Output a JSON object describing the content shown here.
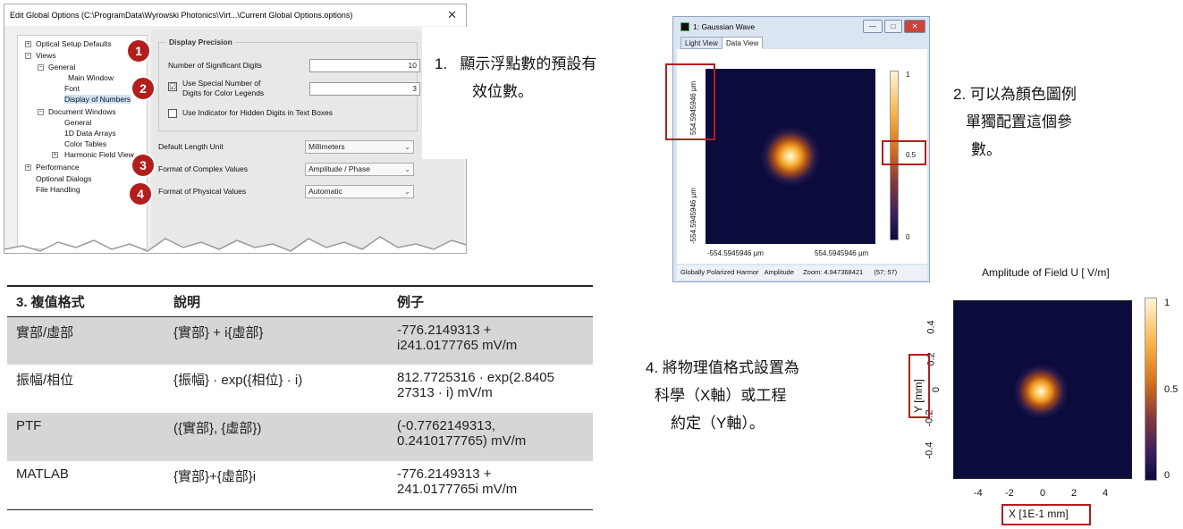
{
  "dialog": {
    "title": "Edit Global Options (C:\\ProgramData\\Wyrowski Photonics\\Virt...\\Current Global Options.options)",
    "close_glyph": "✕",
    "tree": [
      {
        "label": "Optical Setup Defaults",
        "expander": "+"
      },
      {
        "label": "Views",
        "expander": "−"
      },
      {
        "label": "General",
        "expander": "−"
      },
      {
        "label": "Main Window"
      },
      {
        "label": "Font"
      },
      {
        "label": "Display of Numbers",
        "selected": true
      },
      {
        "label": "Document Windows",
        "expander": "−"
      },
      {
        "label": "General"
      },
      {
        "label": "1D Data Arrays"
      },
      {
        "label": "Color Tables"
      },
      {
        "label": "Harmonic Field View",
        "expander": "+"
      },
      {
        "label": "Performance",
        "expander": "+"
      },
      {
        "label": "Optional Dialogs"
      },
      {
        "label": "File Handling"
      }
    ],
    "group_title": "Display Precision",
    "sig_digits_label": "Number of Significant Digits",
    "sig_digits_value": "10",
    "special_label_1": "Use Special Number of",
    "special_label_2": "Digits for Color Legends",
    "special_value": "3",
    "special_checked": "☑",
    "indicator_label": "Use Indicator for Hidden Digits in Text Boxes",
    "length_unit_label": "Default Length Unit",
    "length_unit_value": "Millimeters",
    "complex_label": "Format of Complex Values",
    "complex_value": "Amplitude / Phase",
    "physical_label": "Format of Physical Values",
    "physical_value": "Automatic",
    "badges": [
      "1",
      "2",
      "3",
      "4"
    ]
  },
  "annotations": {
    "a1_line1": "1.   顯示浮點數的預設有",
    "a1_line2": "效位數。",
    "a2_line1": "2. 可以為顏色圖例",
    "a2_line2": "單獨配置這個參",
    "a2_line3": "數。",
    "a4_line1": "4. 將物理值格式設置為",
    "a4_line2": "科學（X軸）或工程",
    "a4_line3": "約定（Y軸）。"
  },
  "table": {
    "headers": [
      "3. 複值格式",
      "說明",
      "例子"
    ],
    "rows": [
      [
        "實部/虛部",
        "{實部} + i{虛部}",
        "-776.2149313 +\ni241.0177765 mV/m"
      ],
      [
        "振幅/相位",
        "{振幅} · exp({相位} · i)",
        "812.7725316 · exp(2.8405\n27313 · i) mV/m"
      ],
      [
        "PTF",
        "({實部}, {虛部})",
        "(-0.7762149313,\n0.2410177765) mV/m"
      ],
      [
        "MATLAB",
        "{實部}+{虛部}i",
        "-776.2149313 +\n241.0177765i mV/m"
      ]
    ]
  },
  "gaussian_window": {
    "title": "1: Gaussian Wave",
    "tabs": [
      "Light View",
      "Data View"
    ],
    "active_tab": "Data View",
    "y_top_label": "554.5945946 µm",
    "y_bottom_label": "-554.5945946 µm",
    "x_left_label": "-554.5945946 µm",
    "x_right_label": "554.5945946 µm",
    "cbar_ticks": [
      "1",
      "0.5",
      "0"
    ],
    "status": [
      "Globally Polarized Harmor",
      "Amplitude",
      "Zoom: 4.947368421",
      "(57; 57)"
    ],
    "buttons": [
      "—",
      "□",
      "✕"
    ]
  },
  "amplitude_plot": {
    "title": "Amplitude of Field U  [ V/m]",
    "y_ticks": [
      "0.4",
      "0.2",
      "0",
      "-0.2",
      "-0.4"
    ],
    "x_ticks": [
      "-4",
      "-2",
      "0",
      "2",
      "4"
    ],
    "ylabel": "Y [mm]",
    "xlabel": "X [1E-1 mm]",
    "cbar_ticks": [
      "1",
      "0.5",
      "0"
    ]
  }
}
